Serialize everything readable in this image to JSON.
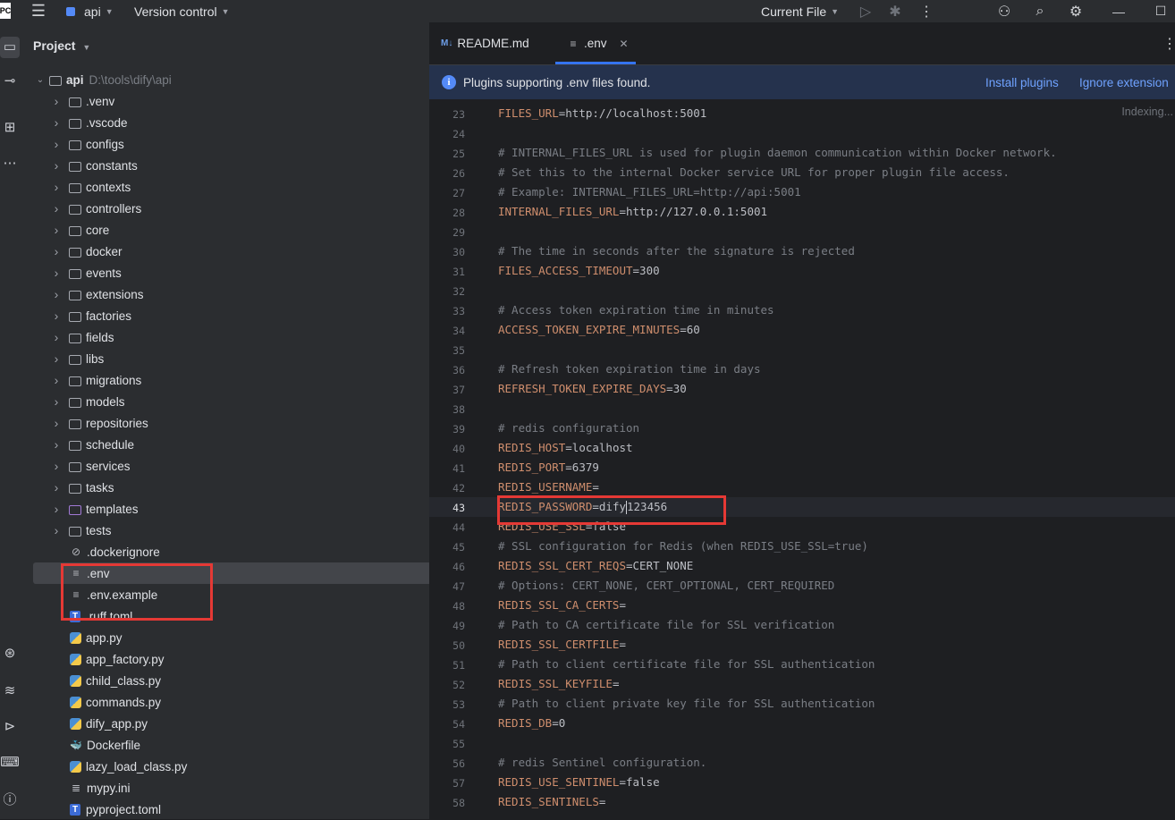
{
  "titlebar": {
    "app_badge": "PC",
    "project_name": "api",
    "vcs_label": "Version control",
    "run_config": "Current File"
  },
  "project_panel": {
    "title": "Project",
    "root": {
      "name": "api",
      "path": "D:\\tools\\dify\\api"
    },
    "folders": [
      ".venv",
      ".vscode",
      "configs",
      "constants",
      "contexts",
      "controllers",
      "core",
      "docker",
      "events",
      "extensions",
      "factories",
      "fields",
      "libs",
      "migrations",
      "models",
      "repositories",
      "schedule",
      "services",
      "tasks",
      "templates",
      "tests"
    ],
    "files": [
      {
        "name": ".dockerignore",
        "icon": "ignore-icon"
      },
      {
        "name": ".env",
        "icon": "text-file-icon"
      },
      {
        "name": ".env.example",
        "icon": "text-file-icon"
      },
      {
        "name": ".ruff.toml",
        "icon": "toml-icon"
      },
      {
        "name": "app.py",
        "icon": "python-icon"
      },
      {
        "name": "app_factory.py",
        "icon": "python-icon"
      },
      {
        "name": "child_class.py",
        "icon": "python-icon"
      },
      {
        "name": "commands.py",
        "icon": "python-icon"
      },
      {
        "name": "dify_app.py",
        "icon": "python-icon"
      },
      {
        "name": "Dockerfile",
        "icon": "docker-icon"
      },
      {
        "name": "lazy_load_class.py",
        "icon": "python-icon"
      },
      {
        "name": "mypy.ini",
        "icon": "ini-icon"
      },
      {
        "name": "pyproject.toml",
        "icon": "toml-icon"
      }
    ]
  },
  "tabs": [
    {
      "label": "README.md",
      "active": false
    },
    {
      "label": ".env",
      "active": true
    }
  ],
  "notice": {
    "text": "Plugins supporting .env files found.",
    "install_label": "Install plugins",
    "ignore_label": "Ignore extension"
  },
  "status": {
    "indexing": "Indexing..."
  },
  "editor": {
    "lines": [
      {
        "n": "23",
        "key": "FILES_URL",
        "val": "http://localhost:5001"
      },
      {
        "n": "24"
      },
      {
        "n": "25",
        "comment": "# INTERNAL_FILES_URL is used for plugin daemon communication within Docker network."
      },
      {
        "n": "26",
        "comment": "# Set this to the internal Docker service URL for proper plugin file access."
      },
      {
        "n": "27",
        "comment": "# Example: INTERNAL_FILES_URL=http://api:5001"
      },
      {
        "n": "28",
        "key": "INTERNAL_FILES_URL",
        "val": "http://127.0.0.1:5001"
      },
      {
        "n": "29"
      },
      {
        "n": "30",
        "comment": "# The time in seconds after the signature is rejected"
      },
      {
        "n": "31",
        "key": "FILES_ACCESS_TIMEOUT",
        "val": "300"
      },
      {
        "n": "32"
      },
      {
        "n": "33",
        "comment": "# Access token expiration time in minutes"
      },
      {
        "n": "34",
        "key": "ACCESS_TOKEN_EXPIRE_MINUTES",
        "val": "60"
      },
      {
        "n": "35"
      },
      {
        "n": "36",
        "comment": "# Refresh token expiration time in days"
      },
      {
        "n": "37",
        "key": "REFRESH_TOKEN_EXPIRE_DAYS",
        "val": "30"
      },
      {
        "n": "38"
      },
      {
        "n": "39",
        "comment": "# redis configuration"
      },
      {
        "n": "40",
        "key": "REDIS_HOST",
        "val": "localhost"
      },
      {
        "n": "41",
        "key": "REDIS_PORT",
        "val": "6379"
      },
      {
        "n": "42",
        "key": "REDIS_USERNAME",
        "val": ""
      },
      {
        "n": "43",
        "key": "REDIS_PASSWORD",
        "val": "dify123456",
        "current": true
      },
      {
        "n": "44",
        "key": "REDIS_USE_SSL",
        "val": "false"
      },
      {
        "n": "45",
        "comment": "# SSL configuration for Redis (when REDIS_USE_SSL=true)"
      },
      {
        "n": "46",
        "key": "REDIS_SSL_CERT_REQS",
        "val": "CERT_NONE"
      },
      {
        "n": "47",
        "comment": "# Options: CERT_NONE, CERT_OPTIONAL, CERT_REQUIRED"
      },
      {
        "n": "48",
        "key": "REDIS_SSL_CA_CERTS",
        "val": ""
      },
      {
        "n": "49",
        "comment": "# Path to CA certificate file for SSL verification"
      },
      {
        "n": "50",
        "key": "REDIS_SSL_CERTFILE",
        "val": ""
      },
      {
        "n": "51",
        "comment": "# Path to client certificate file for SSL authentication"
      },
      {
        "n": "52",
        "key": "REDIS_SSL_KEYFILE",
        "val": ""
      },
      {
        "n": "53",
        "comment": "# Path to client private key file for SSL authentication"
      },
      {
        "n": "54",
        "key": "REDIS_DB",
        "val": "0"
      },
      {
        "n": "55"
      },
      {
        "n": "56",
        "comment": "# redis Sentinel configuration."
      },
      {
        "n": "57",
        "key": "REDIS_USE_SENTINEL",
        "val": "false"
      },
      {
        "n": "58",
        "key": "REDIS_SENTINELS",
        "val": ""
      }
    ]
  }
}
